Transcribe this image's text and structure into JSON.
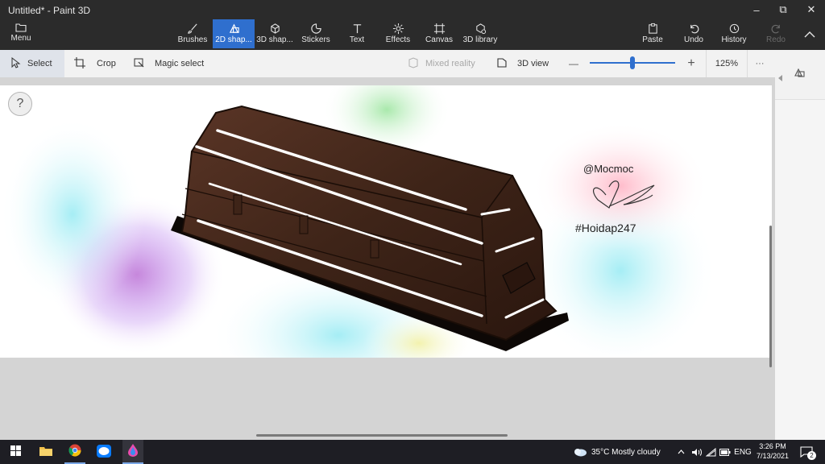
{
  "window": {
    "title": "Untitled* - Paint 3D"
  },
  "window_controls": {
    "minimize": "–",
    "restore": "⧉",
    "close": "✕"
  },
  "ribbon": {
    "menu_label": "Menu",
    "tools": [
      {
        "id": "brushes",
        "label": "Brushes",
        "icon": "brush-icon"
      },
      {
        "id": "2d-shapes",
        "label": "2D shap...",
        "icon": "2d-shapes-icon",
        "active": true
      },
      {
        "id": "3d-shapes",
        "label": "3D shap...",
        "icon": "3d-shapes-icon"
      },
      {
        "id": "stickers",
        "label": "Stickers",
        "icon": "sticker-icon"
      },
      {
        "id": "text",
        "label": "Text",
        "icon": "text-icon"
      },
      {
        "id": "effects",
        "label": "Effects",
        "icon": "effects-icon"
      },
      {
        "id": "canvas",
        "label": "Canvas",
        "icon": "canvas-icon"
      },
      {
        "id": "3d-library",
        "label": "3D library",
        "icon": "3d-library-icon"
      }
    ],
    "paste_label": "Paste",
    "undo_label": "Undo",
    "history_label": "History",
    "redo_label": "Redo"
  },
  "toolbar": {
    "select_label": "Select",
    "crop_label": "Crop",
    "magic_select_label": "Magic select",
    "mixed_reality_label": "Mixed reality",
    "view3d_label": "3D view",
    "zoom_minus": "—",
    "zoom_plus": "+",
    "zoom_fraction": 0.5,
    "zoom_value": "125%",
    "more": "···"
  },
  "canvas": {
    "help": "?",
    "handle": "@Mocmoc",
    "hashtag": "#Hoidap247"
  },
  "taskbar": {
    "weather": "35°C  Mostly cloudy",
    "language": "ENG",
    "time": "3:26 PM",
    "date": "7/13/2021",
    "notifications": "2"
  },
  "colors": {
    "accent": "#2f6fce",
    "title_bar": "#2b2b2b",
    "toolbar": "#f2f2f2",
    "taskbar": "#1e1e24",
    "coffin": "#3e2418"
  }
}
